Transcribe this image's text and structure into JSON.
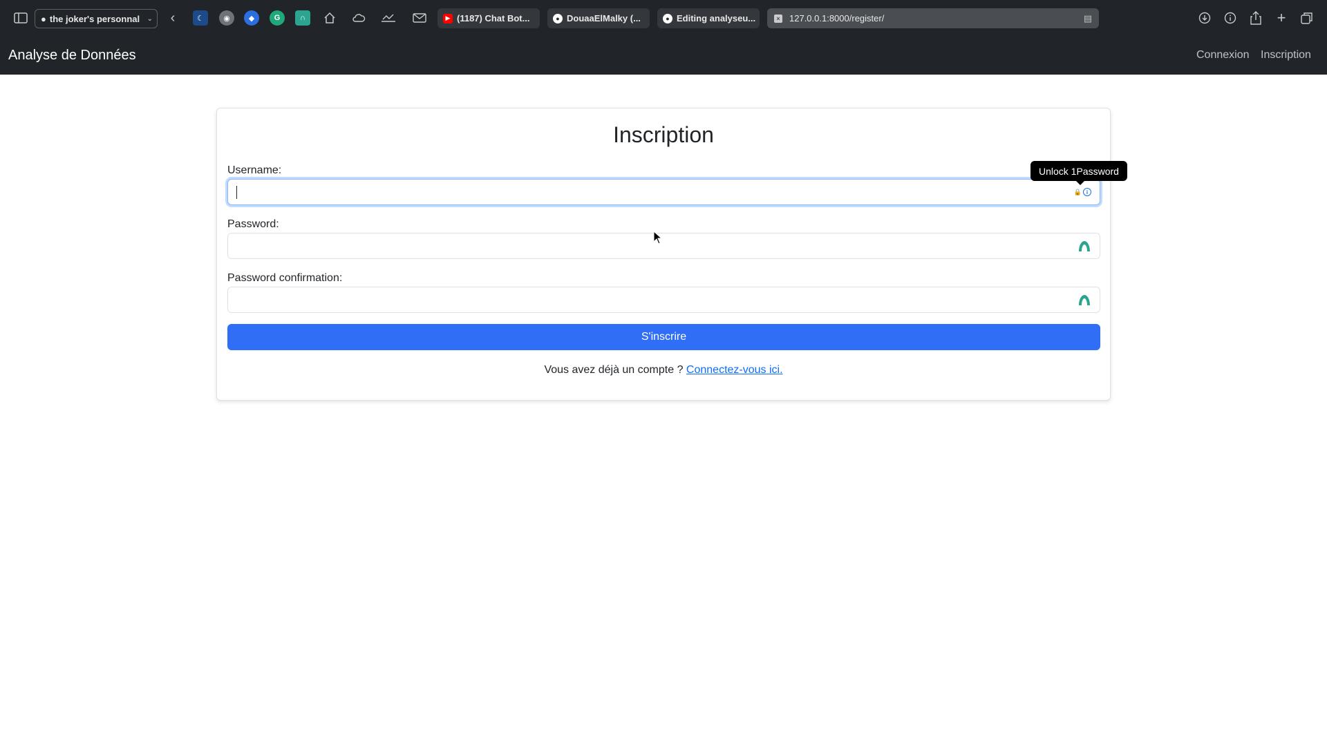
{
  "browser": {
    "profile_label": "the joker's personnal",
    "tabs": [
      {
        "title": "(1187) Chat Bot...",
        "favicon_color": "#ff0000"
      },
      {
        "title": "DouaaElMalky (...",
        "favicon_color": "#ffffff"
      },
      {
        "title": "Editing analyseu...",
        "favicon_color": "#ffffff"
      }
    ],
    "url": "127.0.0.1:8000/register/",
    "toolbar_icons": [
      "sidebar-icon",
      "back-icon",
      "home-icon",
      "cloud-icon",
      "signature-icon",
      "mail-icon",
      "download-icon",
      "info-icon",
      "share-icon",
      "new-tab-icon",
      "tab-overview-icon"
    ]
  },
  "navbar": {
    "brand": "Analyse de Données",
    "links": [
      "Connexion",
      "Inscription"
    ]
  },
  "form": {
    "title": "Inscription",
    "username_label": "Username:",
    "password_label": "Password:",
    "password_confirm_label": "Password confirmation:",
    "submit_label": "S'inscrire",
    "footer_text": "Vous avez déjà un compte ?",
    "footer_link": "Connectez-vous ici."
  },
  "tooltip": {
    "text": "Unlock 1Password"
  },
  "colors": {
    "navbar_bg": "#212529",
    "primary": "#2f6ef5",
    "link": "#0d6efd",
    "password_manager_icon": "#2ba58f"
  }
}
